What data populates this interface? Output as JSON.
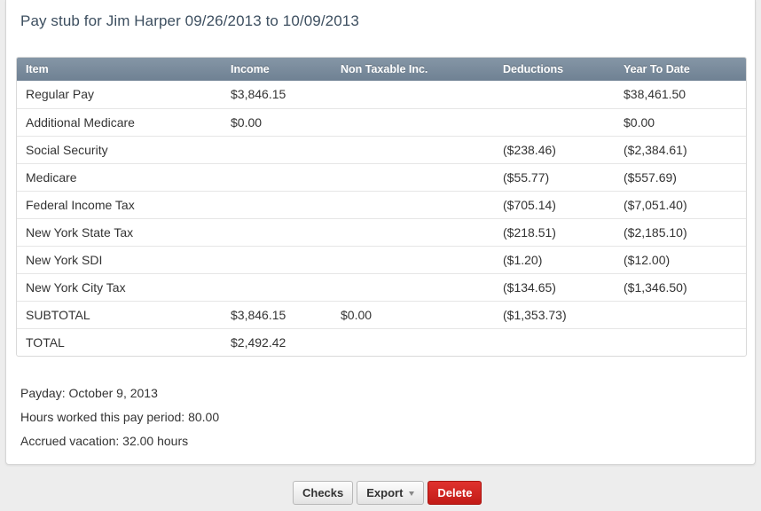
{
  "title": "Pay stub for Jim Harper 09/26/2013 to 10/09/2013",
  "table": {
    "headers": [
      "Item",
      "Income",
      "Non Taxable Inc.",
      "Deductions",
      "Year To Date"
    ],
    "rows": [
      [
        "Regular Pay",
        "$3,846.15",
        "",
        "",
        "$38,461.50"
      ],
      [
        "Additional Medicare",
        "$0.00",
        "",
        "",
        "$0.00"
      ],
      [
        "Social Security",
        "",
        "",
        "($238.46)",
        "($2,384.61)"
      ],
      [
        "Medicare",
        "",
        "",
        "($55.77)",
        "($557.69)"
      ],
      [
        "Federal Income Tax",
        "",
        "",
        "($705.14)",
        "($7,051.40)"
      ],
      [
        "New York State Tax",
        "",
        "",
        "($218.51)",
        "($2,185.10)"
      ],
      [
        "New York SDI",
        "",
        "",
        "($1.20)",
        "($12.00)"
      ],
      [
        "New York City Tax",
        "",
        "",
        "($134.65)",
        "($1,346.50)"
      ],
      [
        "SUBTOTAL",
        "$3,846.15",
        "$0.00",
        "($1,353.73)",
        ""
      ],
      [
        "TOTAL",
        "$2,492.42",
        "",
        "",
        ""
      ]
    ]
  },
  "info": {
    "payday": "Payday: October 9, 2013",
    "hours": "Hours worked this pay period: 80.00",
    "vacation": "Accrued vacation: 32.00 hours"
  },
  "buttons": {
    "checks": "Checks",
    "export": "Export",
    "delete": "Delete"
  },
  "colors": {
    "header_bg": "#7a8b9c",
    "title": "#3d4f60",
    "delete_bg": "#cf2420"
  }
}
